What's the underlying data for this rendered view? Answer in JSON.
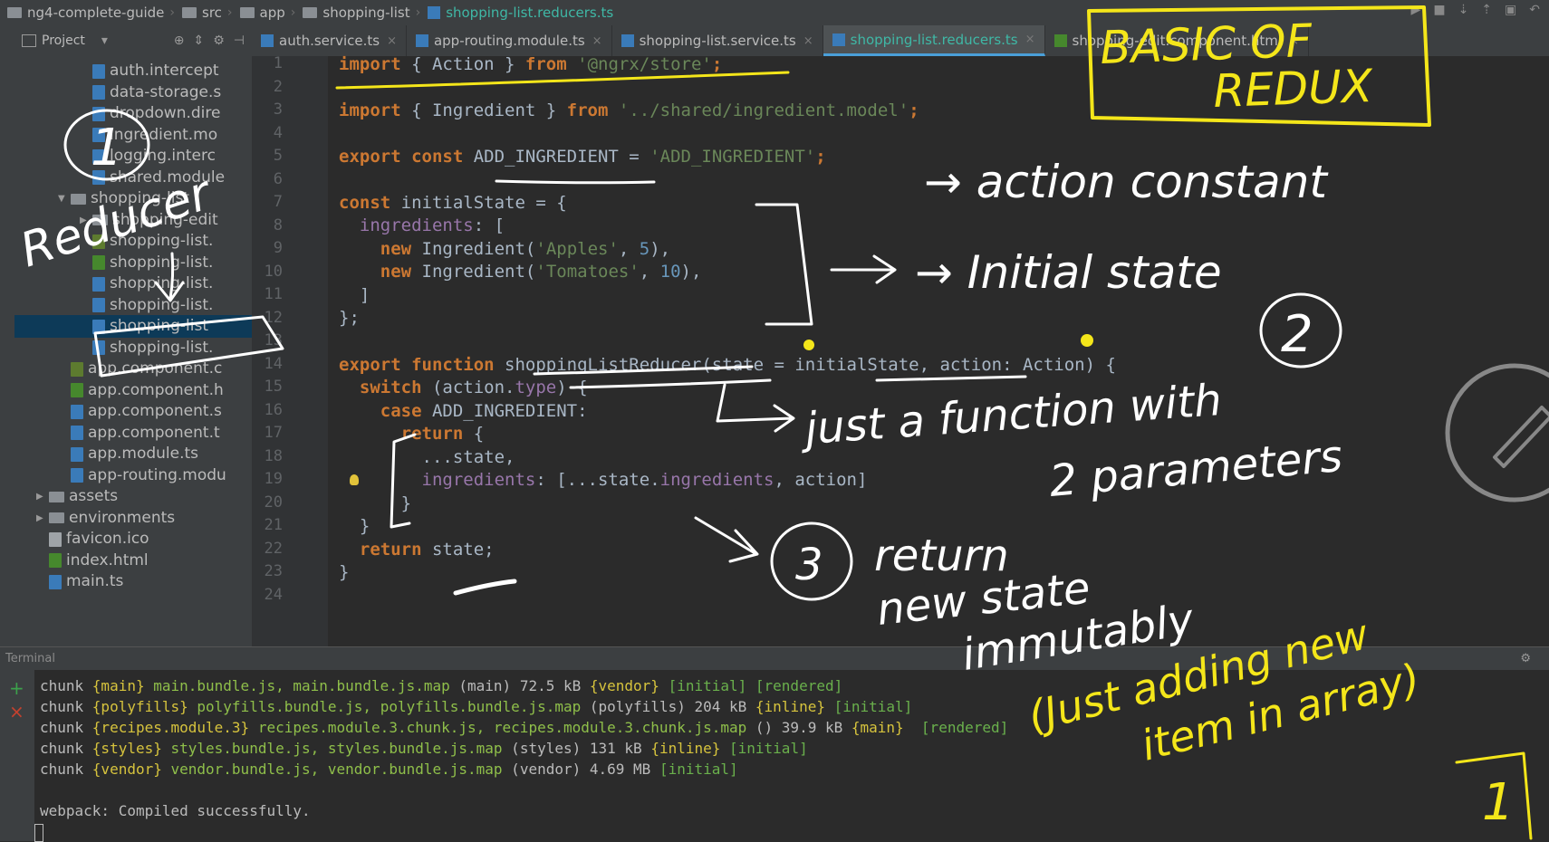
{
  "breadcrumb": [
    "ng4-complete-guide",
    "src",
    "app",
    "shopping-list",
    "shopping-list.reducers.ts"
  ],
  "project_panel": {
    "label": "Project",
    "items": [
      {
        "label": "auth.intercept",
        "icon": "ts-file-icon",
        "indent": 2
      },
      {
        "label": "data-storage.s",
        "icon": "ts-file-icon",
        "indent": 2
      },
      {
        "label": "dropdown.dire",
        "icon": "ts-file-icon",
        "indent": 2
      },
      {
        "label": "ingredient.mo",
        "icon": "ts-file-icon",
        "indent": 2
      },
      {
        "label": "logging.interc",
        "icon": "ts-file-icon",
        "indent": 2
      },
      {
        "label": "shared.module",
        "icon": "ts-file-icon",
        "indent": 2
      },
      {
        "label": "shopping-list",
        "icon": "folder-icon",
        "indent": 1
      },
      {
        "label": "shopping-edit",
        "icon": "folder-icon",
        "indent": 2
      },
      {
        "label": "shopping-list.",
        "icon": "css-file-icon",
        "indent": 2
      },
      {
        "label": "shopping-list.",
        "icon": "html-file-icon",
        "indent": 2
      },
      {
        "label": "shopping-list.",
        "icon": "ts-file-icon",
        "indent": 2
      },
      {
        "label": "shopping-list.",
        "icon": "ts-file-icon",
        "indent": 2
      },
      {
        "label": "shopping-list",
        "icon": "ts-file-icon",
        "indent": 2
      },
      {
        "label": "shopping-list.",
        "icon": "ts-file-icon",
        "indent": 2
      },
      {
        "label": "app.component.c",
        "icon": "css-file-icon",
        "indent": 1
      },
      {
        "label": "app.component.h",
        "icon": "html-file-icon",
        "indent": 1
      },
      {
        "label": "app.component.s",
        "icon": "ts-file-icon",
        "indent": 1
      },
      {
        "label": "app.component.t",
        "icon": "ts-file-icon",
        "indent": 1
      },
      {
        "label": "app.module.ts",
        "icon": "ts-file-icon",
        "indent": 1
      },
      {
        "label": "app-routing.modu",
        "icon": "ts-file-icon",
        "indent": 1
      },
      {
        "label": "assets",
        "icon": "folder-icon",
        "indent": 0
      },
      {
        "label": "environments",
        "icon": "folder-icon",
        "indent": 0
      },
      {
        "label": "favicon.ico",
        "icon": "plain-file-icon",
        "indent": 0
      },
      {
        "label": "index.html",
        "icon": "html-file-icon",
        "indent": 0
      },
      {
        "label": "main.ts",
        "icon": "ts-file-icon",
        "indent": 0
      }
    ],
    "selected_index": 12
  },
  "tabs": [
    {
      "label": "auth.service.ts",
      "active": false
    },
    {
      "label": "app-routing.module.ts",
      "active": false
    },
    {
      "label": "shopping-list.service.ts",
      "active": false
    },
    {
      "label": "shopping-list.reducers.ts",
      "active": true
    },
    {
      "label": "shopping-edit.component.html",
      "active": false
    }
  ],
  "line_numbers": [
    "1",
    "2",
    "3",
    "4",
    "5",
    "6",
    "7",
    "8",
    "9",
    "10",
    "11",
    "12",
    "13",
    "14",
    "15",
    "16",
    "17",
    "18",
    "19",
    "20",
    "21",
    "22",
    "23",
    "24"
  ],
  "code": {
    "l1": {
      "a": "import",
      "b": " { Action } ",
      "c": "from",
      "d": " ",
      "e": "'@ngrx/store'",
      "f": ";"
    },
    "l3": {
      "a": "import",
      "b": " { Ingredient } ",
      "c": "from",
      "d": " ",
      "e": "'../shared/ingredient.model'",
      "f": ";"
    },
    "l5": {
      "a": "export const",
      "b": " ADD_INGREDIENT = ",
      "e": "'ADD_INGREDIENT'",
      "f": ";"
    },
    "l7": {
      "a": "const",
      "b": " initialState = {"
    },
    "l8": {
      "p": "ingredients",
      "b": ": ["
    },
    "l9": {
      "a": "new",
      "b": " Ingredient(",
      "e": "'Apples'",
      "c": ", ",
      "n": "5",
      "f": "),"
    },
    "l10": {
      "a": "new",
      "b": " Ingredient(",
      "e": "'Tomatoes'",
      "c": ", ",
      "n": "10",
      "f": "),"
    },
    "l11": {
      "b": "]"
    },
    "l12": {
      "b": "};"
    },
    "l14": {
      "a": "export function",
      "b": " shoppingListReducer(state = initialState, action: Action) {"
    },
    "l15": {
      "a": "switch",
      "b": " (action.",
      "p": "type",
      "f": ") {"
    },
    "l16": {
      "a": "case",
      "b": " ADD_INGREDIENT:"
    },
    "l17": {
      "a": "return",
      "b": " {"
    },
    "l18": {
      "b": "...state,"
    },
    "l19": {
      "p": "ingredients",
      "b": ": [...state.",
      "p2": "ingredients",
      "f": ", action]"
    },
    "l20": {
      "b": "}"
    },
    "l21": {
      "b": "}"
    },
    "l22": {
      "a": "return",
      "b": " state;"
    },
    "l23": {
      "b": "}"
    }
  },
  "terminal": {
    "label": "Terminal",
    "lines": [
      {
        "a": "chunk ",
        "b": "{main}",
        "c": " main.bundle.js, main.bundle.js.map",
        "d": " (main) 72.5 kB ",
        "e": "{vendor}",
        "f": " [initial] [rendered]"
      },
      {
        "a": "chunk ",
        "b": "{polyfills}",
        "c": " polyfills.bundle.js, polyfills.bundle.js.map",
        "d": " (polyfills) 204 kB ",
        "e": "{inline}",
        "f": " [initial]"
      },
      {
        "a": "chunk ",
        "b": "{recipes.module.3}",
        "c": " recipes.module.3.chunk.js, recipes.module.3.chunk.js.map",
        "d": " () 39.9 kB ",
        "e": "{main}",
        "f": "  [rendered]"
      },
      {
        "a": "chunk ",
        "b": "{styles}",
        "c": " styles.bundle.js, styles.bundle.js.map",
        "d": " (styles) 131 kB ",
        "e": "{inline}",
        "f": " [initial]"
      },
      {
        "a": "chunk ",
        "b": "{vendor}",
        "c": " vendor.bundle.js, vendor.bundle.js.map",
        "d": " (vendor) 4.69 MB ",
        "e": "",
        "f": "[initial]"
      }
    ],
    "status": "webpack: Compiled successfully."
  },
  "annotations": {
    "title_l1": "BASIC OF",
    "title_l2": "REDUX",
    "action_constant": "→ action constant",
    "initial_state": "→ Initial state",
    "num1": "1",
    "reducer": "Reducer",
    "num2": "2",
    "just_function": "just a function with",
    "two_params": "2 parameters",
    "num3": "3",
    "return_l1": "return",
    "return_l2": "new state",
    "return_l3": "immutably",
    "just_adding_l1": "(Just adding new",
    "just_adding_l2": "item in array)",
    "page": "1",
    "colors": {
      "yellow": "#f4e61a",
      "white": "#ffffff"
    }
  }
}
